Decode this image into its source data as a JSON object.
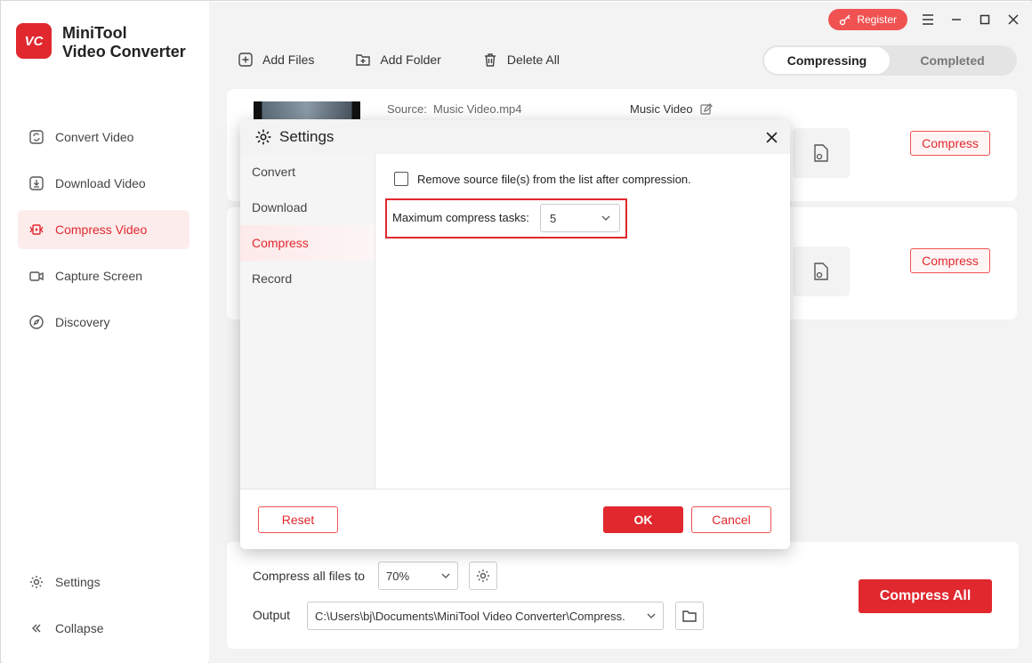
{
  "app": {
    "logo_text": "VC",
    "title_line1": "MiniTool",
    "title_line2": "Video Converter",
    "accent": "#e0282e"
  },
  "sidebar": {
    "items": [
      {
        "label": "Convert Video",
        "icon": "convert-icon"
      },
      {
        "label": "Download Video",
        "icon": "download-icon"
      },
      {
        "label": "Compress Video",
        "icon": "compress-icon",
        "active": true
      },
      {
        "label": "Capture Screen",
        "icon": "camera-icon"
      },
      {
        "label": "Discovery",
        "icon": "compass-icon"
      }
    ],
    "settings_label": "Settings",
    "collapse_label": "Collapse"
  },
  "titlebar": {
    "register_label": "Register"
  },
  "toolbar": {
    "add_files": "Add Files",
    "add_folder": "Add Folder",
    "delete_all": "Delete All"
  },
  "tabs": {
    "compressing": "Compressing",
    "completed": "Completed"
  },
  "files": [
    {
      "source_label": "Source:",
      "source_name": "Music Video.mp4",
      "target_name": "Music Video",
      "compress_label": "Compress"
    },
    {
      "compress_label": "Compress"
    }
  ],
  "bottom": {
    "compress_all_label": "Compress all files to",
    "ratio_value": "70%",
    "output_label": "Output",
    "output_path": "C:\\Users\\bj\\Documents\\MiniTool Video Converter\\Compress.",
    "compress_all_button": "Compress All"
  },
  "dialog": {
    "title": "Settings",
    "tabs": [
      "Convert",
      "Download",
      "Compress",
      "Record"
    ],
    "active_tab": "Compress",
    "remove_source_label": "Remove source file(s) from the list after compression.",
    "remove_source_checked": false,
    "max_tasks_label": "Maximum compress tasks:",
    "max_tasks_value": "5",
    "reset_label": "Reset",
    "ok_label": "OK",
    "cancel_label": "Cancel"
  }
}
